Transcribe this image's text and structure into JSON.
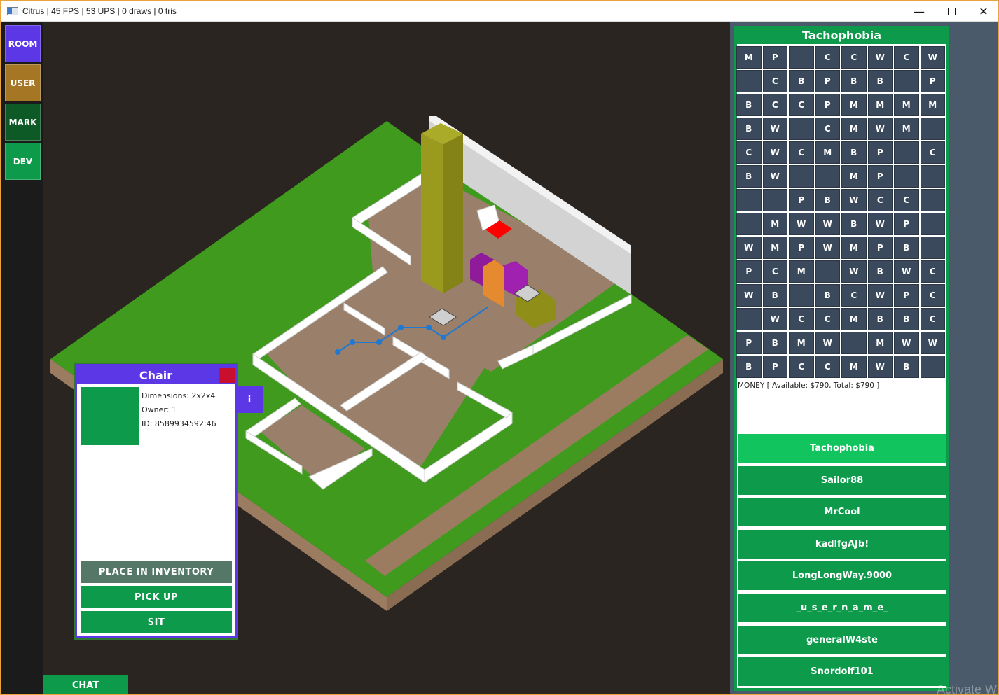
{
  "window": {
    "title": "Citrus | 45 FPS | 53 UPS | 0 draws | 0 tris",
    "minimize": "—",
    "close": "✕"
  },
  "nav": {
    "room": "ROOM",
    "user": "USER",
    "mark": "MARK",
    "dev": "DEV"
  },
  "chat_label": "CHAT",
  "chair": {
    "title": "Chair",
    "dimensions": "Dimensions: 2x2x4",
    "owner": "Owner: 1",
    "id": "ID: 8589934592:46",
    "place_inventory": "PLACE IN INVENTORY",
    "pick_up": "PICK UP",
    "sit": "SIT",
    "info": "i"
  },
  "room_panel": {
    "title": "Tachophobia",
    "grid": [
      [
        "M",
        "P",
        "",
        "C",
        "C",
        "W",
        "C",
        "W"
      ],
      [
        "",
        "C",
        "B",
        "P",
        "B",
        "B",
        "",
        "P"
      ],
      [
        "B",
        "C",
        "C",
        "P",
        "M",
        "M",
        "M",
        "M"
      ],
      [
        "B",
        "W",
        "",
        "C",
        "M",
        "W",
        "M",
        ""
      ],
      [
        "C",
        "W",
        "C",
        "M",
        "B",
        "P",
        "",
        "C"
      ],
      [
        "B",
        "W",
        "",
        "",
        "M",
        "P",
        "",
        ""
      ],
      [
        "",
        "",
        "P",
        "B",
        "W",
        "C",
        "C",
        ""
      ],
      [
        "",
        "M",
        "W",
        "W",
        "B",
        "W",
        "P",
        ""
      ],
      [
        "W",
        "M",
        "P",
        "W",
        "M",
        "P",
        "B",
        ""
      ],
      [
        "P",
        "C",
        "M",
        "",
        "W",
        "B",
        "W",
        "C"
      ],
      [
        "W",
        "B",
        "",
        "B",
        "C",
        "W",
        "P",
        "C"
      ],
      [
        "",
        "W",
        "C",
        "C",
        "M",
        "B",
        "B",
        "C"
      ],
      [
        "P",
        "B",
        "M",
        "W",
        "",
        "M",
        "W",
        "W"
      ],
      [
        "B",
        "P",
        "C",
        "C",
        "M",
        "W",
        "B",
        ""
      ]
    ],
    "money": "MONEY [ Available: $790, Total: $790 ]",
    "users": [
      "Tachophobia",
      "Sailor88",
      "MrCool",
      "kadlfgAJb!",
      "LongLongWay.9000",
      "_u_s_e_r_n_a_m_e_",
      "generalW4ste",
      "Snordolf101"
    ]
  },
  "watermark": "Activate W",
  "colors": {
    "accent": "#5b37e6",
    "green": "#0e9a4b",
    "grass": "#3f9a1e",
    "floor": "#9a806a"
  }
}
